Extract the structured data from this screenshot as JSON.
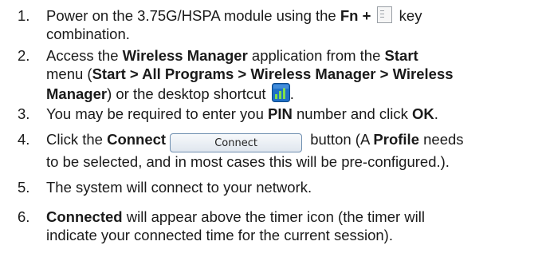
{
  "steps": [
    {
      "num": "1.",
      "a": "Power on the 3.75G/HSPA module using the ",
      "b1": "Fn +",
      "c": " key",
      "d": "combination."
    },
    {
      "num": "2.",
      "a": "Access the ",
      "b1": "Wireless Manager",
      "c": " application from the ",
      "b2": "Start",
      "d": "menu (",
      "b3": "Start > All Programs > Wireless Manager > Wireless",
      "e_b": "Manager",
      "e": ") or the desktop shortcut ",
      "f": "."
    },
    {
      "num": "3.",
      "a": "You may be required to enter you ",
      "b1": "PIN",
      "c": " number and click ",
      "b2": "OK",
      "d": "."
    },
    {
      "num": "4.",
      "a": "Click the ",
      "b1": "Connect",
      "btn": "Connect",
      "c": " button (A ",
      "b2": "Profile",
      "d": " needs",
      "e": "to be selected, and in most cases this will be pre-configured.)."
    },
    {
      "num": "5.",
      "a": "The system will connect to your network."
    },
    {
      "num": "6.",
      "b1": "Connected",
      "a": " will appear above the timer icon (the timer will",
      "c": "indicate your connected time for the current session)."
    }
  ],
  "icons": {
    "key": "keyboard-key-icon",
    "app": "wireless-manager-icon"
  }
}
